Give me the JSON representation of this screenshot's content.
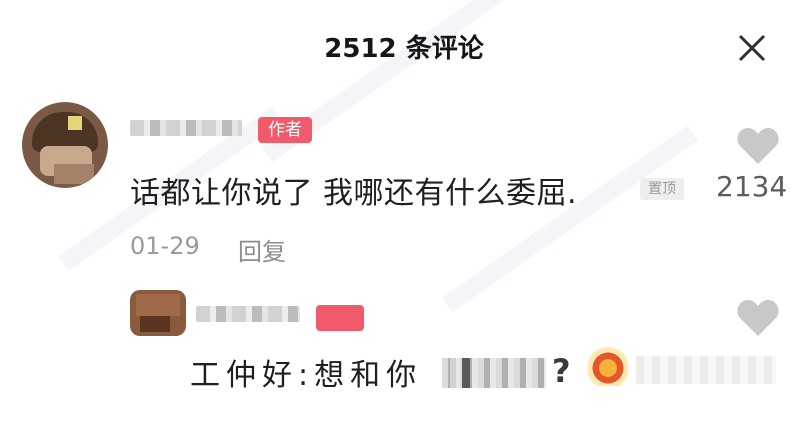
{
  "header": {
    "title": "2512 条评论"
  },
  "comments": [
    {
      "author_tag": "作者",
      "text": "话都让你说了 我哪还有什么委屈.",
      "pin_label": "置顶",
      "date": "01-29",
      "reply_label": "回复",
      "likes": "2134"
    }
  ],
  "reply": {
    "tag": "",
    "text": "工仲好:想和你",
    "punct": "?"
  },
  "colors": {
    "tag": "#f05a6a",
    "secondary_text": "#9a9a9a"
  },
  "icons": [
    "close-icon",
    "heart-icon"
  ]
}
